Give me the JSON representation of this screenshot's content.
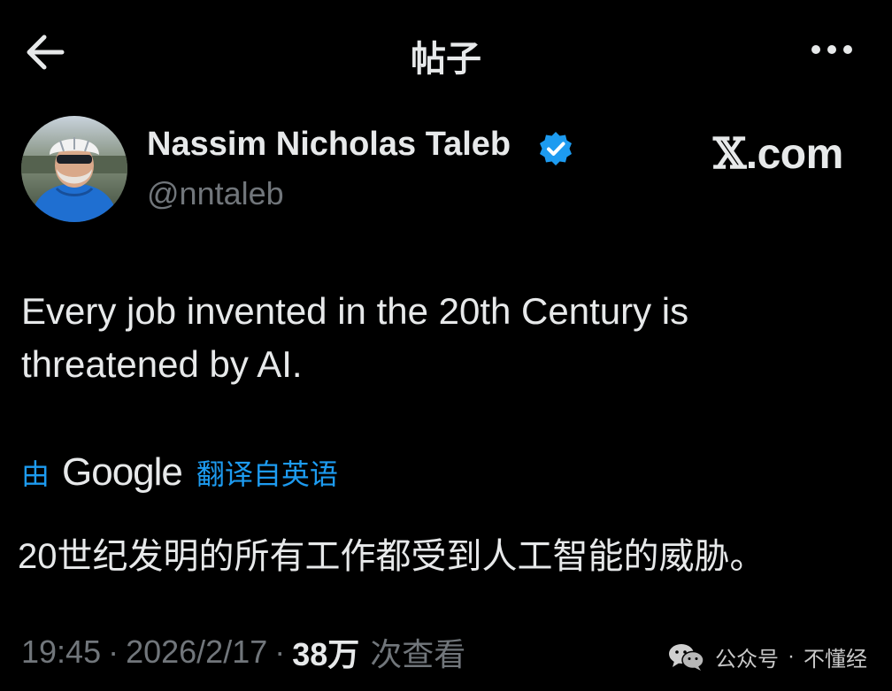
{
  "header": {
    "title": "帖子",
    "back_icon": "arrow-left-icon",
    "more_icon": "more-horizontal-icon"
  },
  "author": {
    "name": "Nassim Nicholas Taleb",
    "handle": "@nntaleb",
    "verified": true,
    "verified_color": "#1d9bf0"
  },
  "brand": {
    "mark": "𝕏",
    "text": ".com"
  },
  "tweet": {
    "text": "Every job invented in the 20th Century is threatened by AI."
  },
  "translation": {
    "by_label": "由",
    "provider": "Google",
    "from_label": "翻译自英语",
    "text": "20世纪发明的所有工作都受到人工智能的威胁。"
  },
  "meta": {
    "time": "19:45",
    "separator": "·",
    "date": "2026/2/17",
    "views_count": "38万",
    "views_label": "次查看"
  },
  "watermark": {
    "icon": "wechat-icon",
    "account_type": "公众号",
    "separator": "·",
    "account_name": "不懂经"
  },
  "colors": {
    "background": "#000000",
    "primary_text": "#e7e9ea",
    "secondary_text": "#71767b",
    "accent": "#1d9bf0"
  }
}
